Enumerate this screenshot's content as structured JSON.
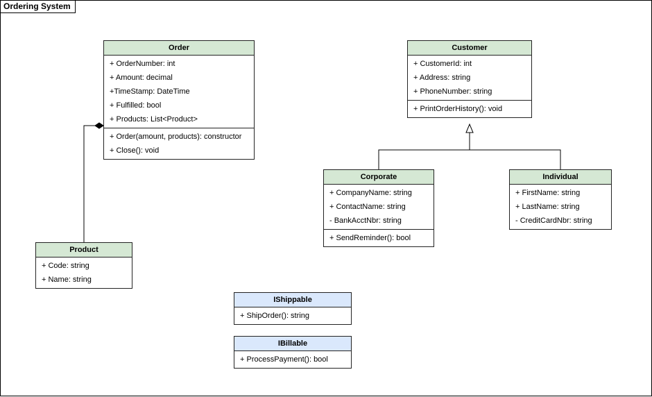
{
  "frame_title": "Ordering System",
  "chart_data": {
    "type": "uml_class_diagram",
    "classes": [
      {
        "name": "Order",
        "style": "green",
        "attributes": [
          "+ OrderNumber: int",
          "+ Amount: decimal",
          "+TimeStamp: DateTime",
          "+ Fulfilled: bool",
          "+ Products: List<Product>"
        ],
        "operations": [
          "+ Order(amount, products): constructor",
          "+ Close(): void"
        ]
      },
      {
        "name": "Customer",
        "style": "green",
        "attributes": [
          "+ CustomerId: int",
          "+ Address: string",
          "+ PhoneNumber: string"
        ],
        "operations": [
          "+ PrintOrderHistory(): void"
        ]
      },
      {
        "name": "Corporate",
        "style": "green",
        "attributes": [
          "+ CompanyName: string",
          "+ ContactName: string",
          "- BankAcctNbr: string"
        ],
        "operations": [
          "+ SendReminder(): bool"
        ]
      },
      {
        "name": "Individual",
        "style": "green",
        "attributes": [
          "+ FirstName: string",
          "+ LastName: string",
          "- CreditCardNbr: string"
        ],
        "operations": []
      },
      {
        "name": "Product",
        "style": "green",
        "attributes": [
          "+ Code: string",
          "+ Name: string"
        ],
        "operations": []
      },
      {
        "name": "IShippable",
        "style": "blue",
        "attributes": [],
        "operations": [
          "+ ShipOrder(): string"
        ]
      },
      {
        "name": "IBillable",
        "style": "blue",
        "attributes": [],
        "operations": [
          "+ ProcessPayment(): bool"
        ]
      }
    ],
    "relationships": [
      {
        "type": "association",
        "from": "Product",
        "to": "Order",
        "end_marker": "filled_diamond"
      },
      {
        "type": "generalization",
        "from": "Corporate",
        "to": "Customer",
        "end_marker": "hollow_triangle"
      },
      {
        "type": "generalization",
        "from": "Individual",
        "to": "Customer",
        "end_marker": "hollow_triangle"
      }
    ]
  },
  "classes": {
    "order": {
      "title": "Order",
      "attrs": {
        "a0": "+ OrderNumber: int",
        "a1": "+ Amount: decimal",
        "a2": "+TimeStamp: DateTime",
        "a3": "+ Fulfilled: bool",
        "a4": "+ Products: List<Product>"
      },
      "ops": {
        "o0": "+ Order(amount, products): constructor",
        "o1": "+ Close(): void"
      }
    },
    "customer": {
      "title": "Customer",
      "attrs": {
        "a0": "+ CustomerId: int",
        "a1": "+ Address: string",
        "a2": "+ PhoneNumber: string"
      },
      "ops": {
        "o0": "+ PrintOrderHistory(): void"
      }
    },
    "corporate": {
      "title": "Corporate",
      "attrs": {
        "a0": "+ CompanyName: string",
        "a1": "+ ContactName: string",
        "a2": "- BankAcctNbr: string"
      },
      "ops": {
        "o0": "+ SendReminder(): bool"
      }
    },
    "individual": {
      "title": "Individual",
      "attrs": {
        "a0": "+ FirstName: string",
        "a1": "+ LastName: string",
        "a2": "- CreditCardNbr: string"
      }
    },
    "product": {
      "title": "Product",
      "attrs": {
        "a0": "+ Code: string",
        "a1": "+ Name: string"
      }
    },
    "ishippable": {
      "title": "IShippable",
      "ops": {
        "o0": "+ ShipOrder(): string"
      }
    },
    "ibillable": {
      "title": "IBillable",
      "ops": {
        "o0": "+ ProcessPayment(): bool"
      }
    }
  }
}
